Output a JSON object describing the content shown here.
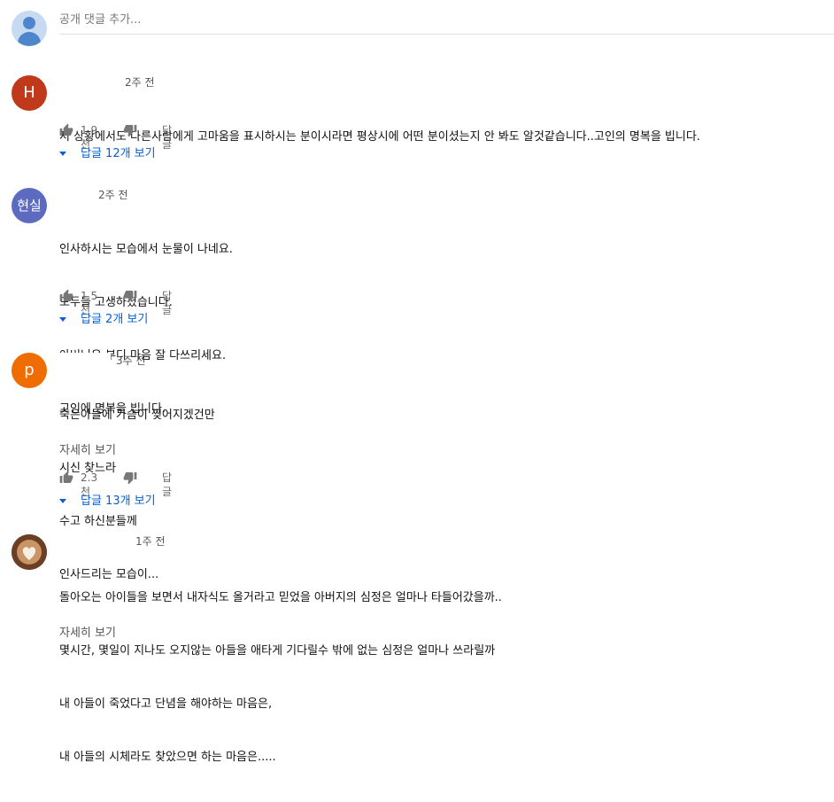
{
  "add_comment": {
    "placeholder": "공개 댓글 추가..."
  },
  "comments": [
    {
      "avatar_letter": "H",
      "avatar_color": "#c0391a",
      "time": "2주 전",
      "lines": [
        "저 상황에서도 다른사람에게 고마움을 표시하시는 분이시라면 평상시에 어떤 분이셨는지 안 봐도 알것같습니다..고인의 명복을 빕니다."
      ],
      "likes": "1.9천",
      "reply_label": "답글",
      "replies": "답글 12개 보기"
    },
    {
      "avatar_letter": "현실",
      "avatar_color": "#5c6bc0",
      "time": "2주 전",
      "lines": [
        "인사하시는 모습에서 눈물이 나네요.",
        "모두들 고생하셨습니다.",
        "아버님은 부디 마음 잘 다쓰리세요.",
        "고인에 명복을 빕니다."
      ],
      "likes": "1.5천",
      "reply_label": "답글",
      "replies": "답글 2개 보기"
    },
    {
      "avatar_letter": "p",
      "avatar_color": "#ef6c00",
      "time": "3주 전",
      "lines": [
        "죽은아들에 가슴이 찢어지겠건만",
        "시신 찾느라",
        "수고 하신분들께",
        "인사드리는 모습이..."
      ],
      "more": "자세히 보기",
      "likes": "2.3천",
      "reply_label": "답글",
      "replies": "답글 13개 보기"
    },
    {
      "avatar_color": "#7a4a30",
      "time": "1주 전",
      "lines": [
        "돌아오는 아이들을 보면서 내자식도 올거라고 믿었을 아버지의 심정은 얼마나 타들어갔을까..",
        "몇시간, 몇일이 지나도 오지않는 아들을 애타게 기다릴수 밖에 없는 심정은 얼마나 쓰라릴까",
        "내 아들이 죽었다고 단념을 해야하는 마음은,",
        "내 아들의 시체라도 찾았으면 하는 마음은....."
      ],
      "more": "자세히 보기"
    }
  ]
}
